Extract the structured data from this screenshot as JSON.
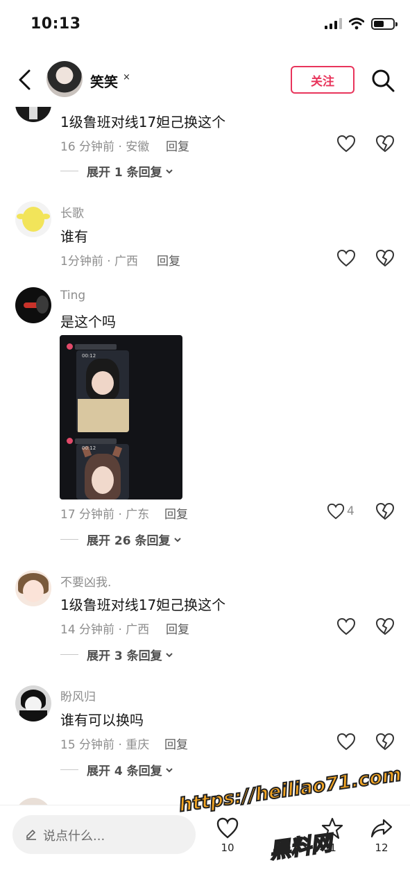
{
  "status_bar": {
    "time": "10:13"
  },
  "header": {
    "username": "笑笑",
    "name_badge": "×",
    "follow_label": "关注"
  },
  "comments": [
    {
      "username": "",
      "text": "1级鲁班对线17妲己换这个",
      "meta": "16 分钟前 · 安徽",
      "reply": "回复",
      "likes": "",
      "expand": "展开 1 条回复"
    },
    {
      "username": "长歌",
      "text": "谁有",
      "meta": "1分钟前 · 广西",
      "reply": "回复",
      "likes": "",
      "expand": ""
    },
    {
      "username": "Ting",
      "text": "是这个吗",
      "meta": "17 分钟前 · 广东",
      "reply": "回复",
      "likes": "4",
      "expand": "展开 26 条回复",
      "image_captions": [
        "00:12",
        "00:12"
      ]
    },
    {
      "username": "不要凶我.",
      "text": "1级鲁班对线17妲己换这个",
      "meta": "14 分钟前 · 广西",
      "reply": "回复",
      "likes": "",
      "expand": "展开 3 条回复"
    },
    {
      "username": "盼风归",
      "text": "谁有可以换吗",
      "meta": "15 分钟前 · 重庆",
      "reply": "回复",
      "likes": "",
      "expand": "展开 4 条回复"
    }
  ],
  "bottom_bar": {
    "input_placeholder": "说点什么...",
    "like_count": "10",
    "collect_count": "1",
    "share_count": "12"
  },
  "watermark": {
    "url": "https://heiliao71.com",
    "name": "黑料网"
  },
  "colors": {
    "accent": "#e8345b",
    "muted_text": "#8d8d8d",
    "watermark": "#f5a623"
  }
}
